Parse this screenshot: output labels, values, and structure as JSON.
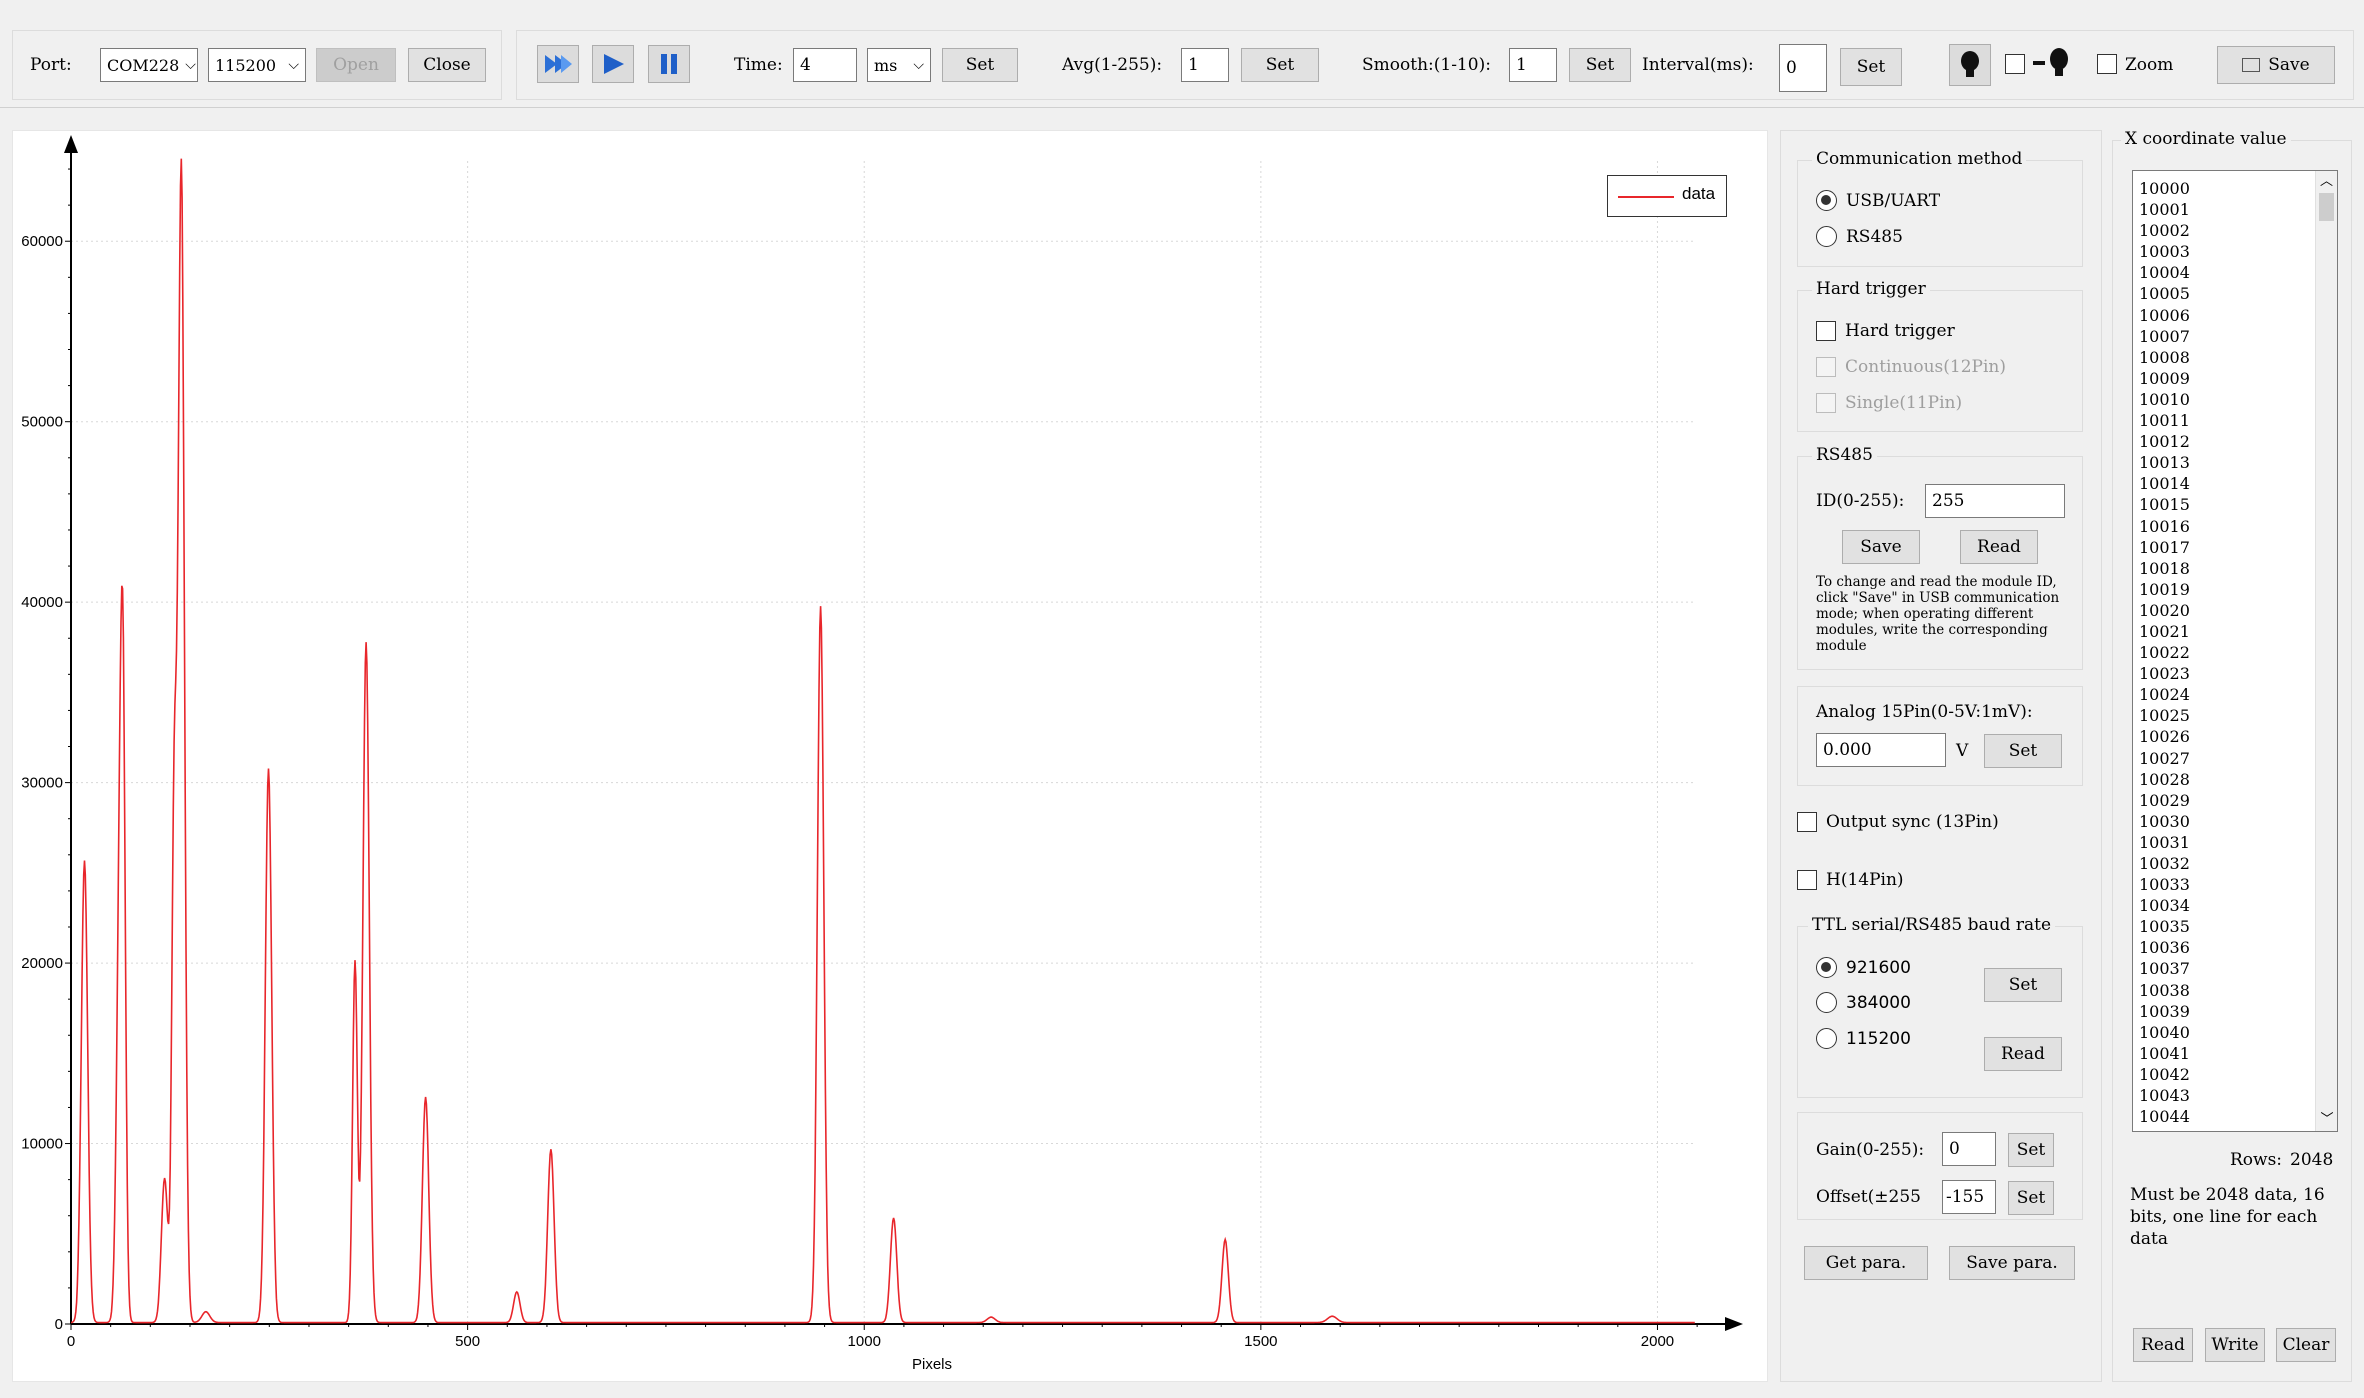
{
  "toolbar": {
    "port_label": "Port:",
    "port_value": "COM228",
    "baud_value": "115200",
    "open_label": "Open",
    "close_label": "Close",
    "time_label": "Time:",
    "time_value": "4",
    "time_unit": "ms",
    "set_label": "Set",
    "avg_label": "Avg(1-255):",
    "avg_value": "1",
    "smooth_label": "Smooth:(1-10):",
    "smooth_value": "1",
    "interval_label": "Interval(ms):",
    "interval_value": "0",
    "zoom_label": "Zoom",
    "save_label": "Save"
  },
  "comm": {
    "title": "Communication method",
    "options": [
      "USB/UART",
      "RS485"
    ],
    "selected": 0
  },
  "hard_trigger": {
    "title": "Hard trigger",
    "hard_trigger_label": "Hard trigger",
    "continuous_label": "Continuous(12Pin)",
    "single_label": "Single(11Pin)"
  },
  "rs485": {
    "title": "RS485",
    "id_label": "ID(0-255):",
    "id_value": "255",
    "save_label": "Save",
    "read_label": "Read",
    "note": "To change and read the module ID, click \"Save\" in USB communication mode; when operating different modules, write the corresponding module"
  },
  "analog": {
    "label": "Analog  15Pin(0-5V:1mV):",
    "value": "0.000",
    "unit": "V",
    "set_label": "Set"
  },
  "output_sync_label": "Output sync (13Pin)",
  "h14_label": "H(14Pin)",
  "baud": {
    "title": "TTL serial/RS485 baud rate",
    "options": [
      "921600",
      "384000",
      "115200"
    ],
    "selected": 0,
    "set_label": "Set",
    "read_label": "Read"
  },
  "gain": {
    "gain_label": "Gain(0-255):",
    "gain_value": "0",
    "offset_label": "Offset(±255",
    "offset_value": "-155",
    "set_label": "Set"
  },
  "get_para_label": "Get para.",
  "save_para_label": "Save para.",
  "xcoord": {
    "title": "X coordinate value",
    "items": [
      "10000",
      "10001",
      "10002",
      "10003",
      "10004",
      "10005",
      "10006",
      "10007",
      "10008",
      "10009",
      "10010",
      "10011",
      "10012",
      "10013",
      "10014",
      "10015",
      "10016",
      "10017",
      "10018",
      "10019",
      "10020",
      "10021",
      "10022",
      "10023",
      "10024",
      "10025",
      "10026",
      "10027",
      "10028",
      "10029",
      "10030",
      "10031",
      "10032",
      "10033",
      "10034",
      "10035",
      "10036",
      "10037",
      "10038",
      "10039",
      "10040",
      "10041",
      "10042",
      "10043",
      "10044"
    ],
    "rows_label": "Rows:",
    "rows_value": "2048",
    "note": "Must be 2048 data, 16 bits, one line for each data",
    "read_label": "Read",
    "write_label": "Write",
    "clear_label": "Clear"
  },
  "colors": {
    "series": "#e8262b",
    "grid": "#d8d8d8"
  },
  "chart_data": {
    "type": "line",
    "xlabel": "Pixels",
    "ylabel": "",
    "xlim": [
      0,
      2070
    ],
    "ylim": [
      0,
      65000
    ],
    "xticks": [
      0,
      500,
      1000,
      1500,
      2000
    ],
    "yticks": [
      0,
      10000,
      20000,
      30000,
      40000,
      50000,
      60000
    ],
    "grid": true,
    "legend": "top-right",
    "series": [
      {
        "name": "data",
        "peaks": [
          {
            "x": 17,
            "y": 25600,
            "w": 4
          },
          {
            "x": 62,
            "y": 26300,
            "w": 4
          },
          {
            "x": 66,
            "y": 22000,
            "w": 3
          },
          {
            "x": 118,
            "y": 8000,
            "w": 4
          },
          {
            "x": 130,
            "y": 27000,
            "w": 3
          },
          {
            "x": 139,
            "y": 64200,
            "w": 4
          },
          {
            "x": 170,
            "y": 600,
            "w": 5
          },
          {
            "x": 249,
            "y": 30700,
            "w": 4
          },
          {
            "x": 358,
            "y": 20000,
            "w": 3
          },
          {
            "x": 372,
            "y": 37700,
            "w": 4
          },
          {
            "x": 447,
            "y": 12500,
            "w": 4
          },
          {
            "x": 562,
            "y": 1700,
            "w": 4
          },
          {
            "x": 605,
            "y": 9600,
            "w": 4
          },
          {
            "x": 945,
            "y": 39700,
            "w": 4
          },
          {
            "x": 1037,
            "y": 5800,
            "w": 4
          },
          {
            "x": 1160,
            "y": 300,
            "w": 5
          },
          {
            "x": 1455,
            "y": 4600,
            "w": 4
          },
          {
            "x": 1590,
            "y": 350,
            "w": 6
          }
        ],
        "baseline": 80
      }
    ]
  }
}
